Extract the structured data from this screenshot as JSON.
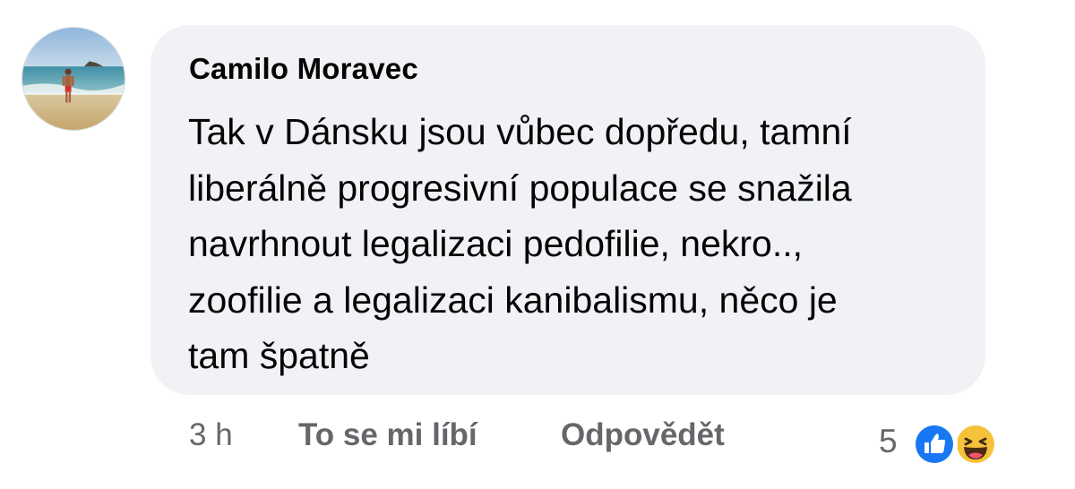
{
  "comment": {
    "author": "Camilo Moravec",
    "text_lines": [
      "Tak v Dánsku jsou vůbec dopředu, tamní",
      "liberálně progresivní populace se snažila",
      "navrhnout legalizaci pedofilie, nekro..,",
      "zoofilie a legalizaci kanibalismu, něco je",
      "tam špatně"
    ],
    "time": "3 h",
    "like_label": "To se mi líbí",
    "reply_label": "Odpovědět",
    "reaction_count": "5",
    "reactions": [
      "like-icon",
      "haha-icon"
    ]
  },
  "colors": {
    "bubble": "#f0f2f5",
    "text": "#050505",
    "secondary": "#65676b",
    "like_blue": "#1877f2",
    "haha_yellow": "#f7c23b"
  }
}
